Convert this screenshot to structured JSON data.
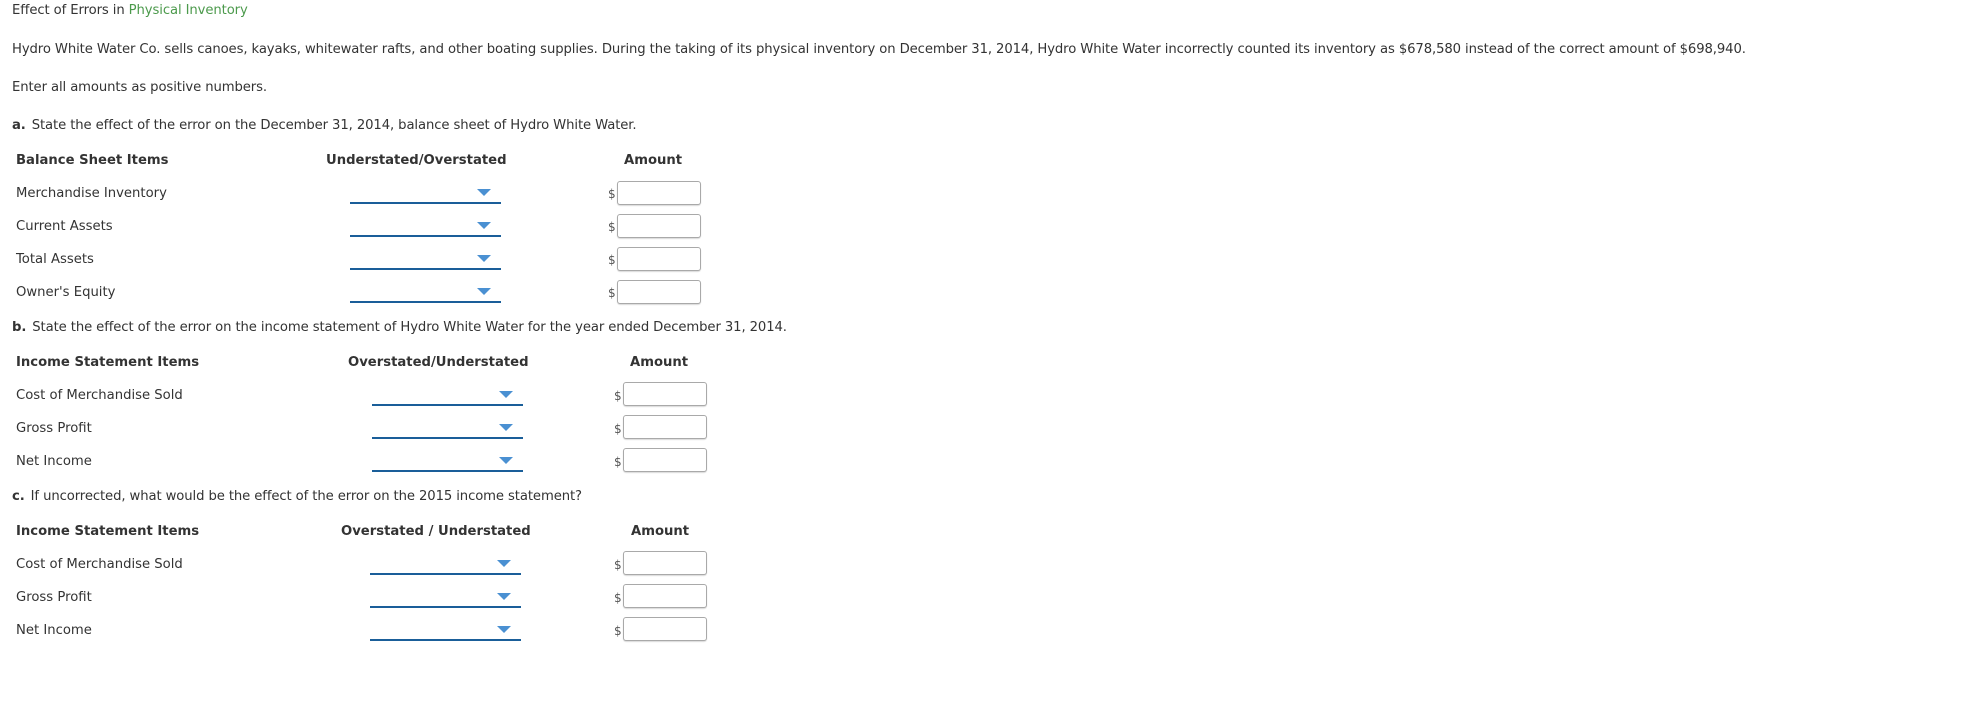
{
  "title": {
    "prefix": "Effect of Errors in",
    "link": "Physical Inventory"
  },
  "intro": "Hydro White Water Co. sells canoes, kayaks, whitewater rafts, and other boating supplies. During the taking of its physical inventory on December 31, 2014, Hydro White Water incorrectly counted its inventory as $678,580 instead of the correct amount of $698,940.",
  "instruction": "Enter all amounts as positive numbers.",
  "colors": {
    "link_green": "#4c9a4c",
    "dropdown_line": "#1a5e99",
    "caret": "#4a90d2"
  },
  "parts": [
    {
      "letter": "a.",
      "question": "State the effect of the error on the December 31, 2014, balance sheet of Hydro White Water.",
      "headers": [
        "Balance Sheet Items",
        "Understated/Overstated",
        "Amount"
      ],
      "rows": [
        {
          "label": "Merchandise Inventory",
          "selection": "",
          "currency": "$",
          "amount": ""
        },
        {
          "label": "Current Assets",
          "selection": "",
          "currency": "$",
          "amount": ""
        },
        {
          "label": "Total Assets",
          "selection": "",
          "currency": "$",
          "amount": ""
        },
        {
          "label": "Owner's Equity",
          "selection": "",
          "currency": "$",
          "amount": ""
        }
      ]
    },
    {
      "letter": "b.",
      "question": "State the effect of the error on the income statement of Hydro White Water for the year ended December 31, 2014.",
      "headers": [
        "Income Statement Items",
        "Overstated/Understated",
        "Amount"
      ],
      "rows": [
        {
          "label": "Cost of Merchandise Sold",
          "selection": "",
          "currency": "$",
          "amount": ""
        },
        {
          "label": "Gross Profit",
          "selection": "",
          "currency": "$",
          "amount": ""
        },
        {
          "label": "Net Income",
          "selection": "",
          "currency": "$",
          "amount": ""
        }
      ]
    },
    {
      "letter": "c.",
      "question": "If uncorrected, what would be the effect of the error on the 2015 income statement?",
      "headers": [
        "Income Statement Items",
        "Overstated / Understated",
        "Amount"
      ],
      "rows": [
        {
          "label": "Cost of Merchandise Sold",
          "selection": "",
          "currency": "$",
          "amount": ""
        },
        {
          "label": "Gross Profit",
          "selection": "",
          "currency": "$",
          "amount": ""
        },
        {
          "label": "Net Income",
          "selection": "",
          "currency": "$",
          "amount": ""
        }
      ]
    }
  ]
}
